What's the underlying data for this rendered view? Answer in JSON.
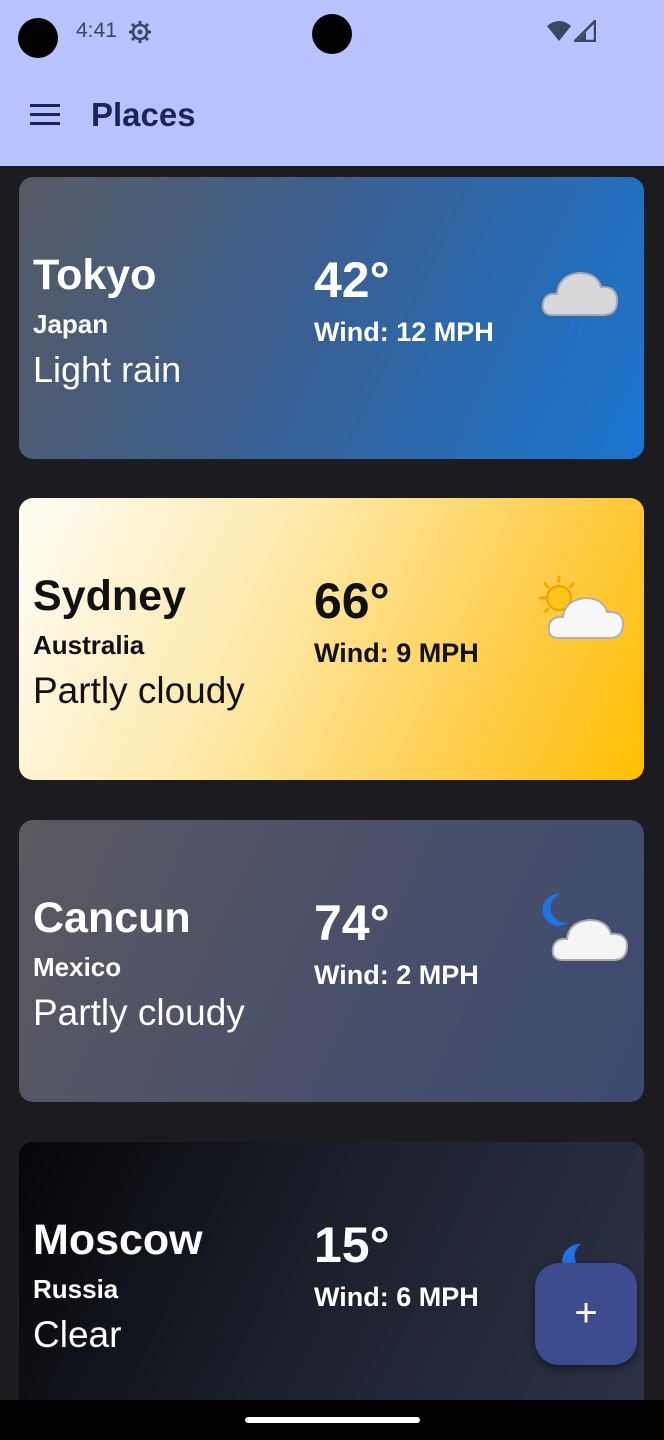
{
  "status_bar": {
    "time": "4:41"
  },
  "app_bar": {
    "title": "Places"
  },
  "places": [
    {
      "city": "Tokyo",
      "country": "Japan",
      "condition": "Light rain",
      "temperature": "42°",
      "wind": "Wind: 12 MPH",
      "icon": "cloud-rain-icon"
    },
    {
      "city": "Sydney",
      "country": "Australia",
      "condition": "Partly cloudy",
      "temperature": "66°",
      "wind": "Wind: 9 MPH",
      "icon": "sun-cloud-icon"
    },
    {
      "city": "Cancun",
      "country": "Mexico",
      "condition": "Partly cloudy",
      "temperature": "74°",
      "wind": "Wind: 2 MPH",
      "icon": "moon-cloud-icon"
    },
    {
      "city": "Moscow",
      "country": "Russia",
      "condition": "Clear",
      "temperature": "15°",
      "wind": "Wind: 6 MPH",
      "icon": "moon-icon"
    }
  ],
  "fab": {
    "label": "+"
  },
  "colors": {
    "app_bar": "#b8c3ff",
    "title": "#1a2463",
    "background": "#1c1b1f",
    "fab": "#3c4c8f"
  }
}
